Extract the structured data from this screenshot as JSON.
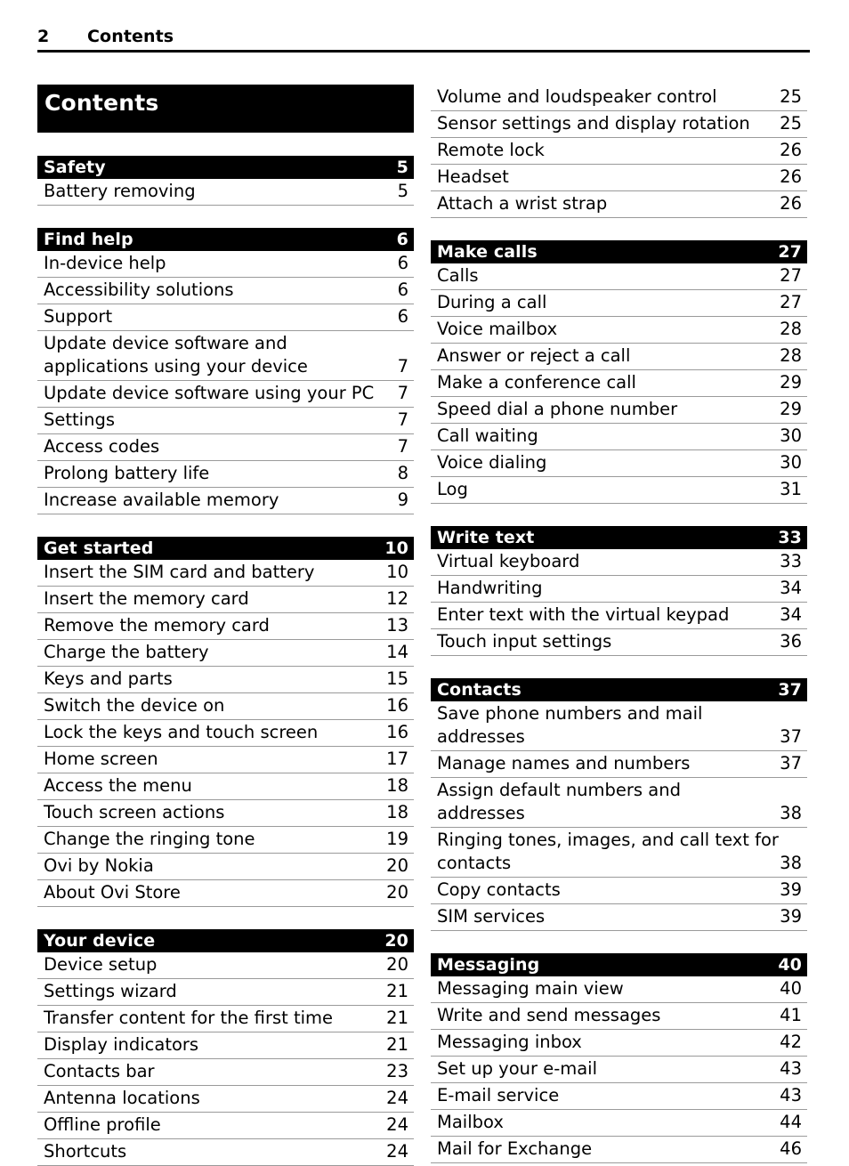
{
  "header": {
    "folio": "2",
    "title": "Contents"
  },
  "title_block": "Contents",
  "left_column": [
    {
      "chapter": {
        "label": "Safety",
        "page": "5"
      },
      "entries": [
        {
          "label": "Battery removing",
          "page": "5"
        }
      ]
    },
    {
      "chapter": {
        "label": "Find help",
        "page": "6"
      },
      "entries": [
        {
          "label": "In-device help",
          "page": "6"
        },
        {
          "label": "Accessibility solutions",
          "page": "6"
        },
        {
          "label": "Support",
          "page": "6"
        },
        {
          "label": "Update device software and",
          "label2": "applications using your device",
          "page": "7"
        },
        {
          "label": "Update device software using your PC",
          "page": "7"
        },
        {
          "label": "Settings",
          "page": "7"
        },
        {
          "label": "Access codes",
          "page": "7"
        },
        {
          "label": "Prolong battery life",
          "page": "8"
        },
        {
          "label": "Increase available memory",
          "page": "9"
        }
      ]
    },
    {
      "chapter": {
        "label": "Get started",
        "page": "10"
      },
      "entries": [
        {
          "label": "Insert the SIM card and battery",
          "page": "10"
        },
        {
          "label": "Insert the memory card",
          "page": "12"
        },
        {
          "label": "Remove the memory card",
          "page": "13"
        },
        {
          "label": "Charge the battery",
          "page": "14"
        },
        {
          "label": "Keys and parts",
          "page": "15"
        },
        {
          "label": "Switch the device on",
          "page": "16"
        },
        {
          "label": "Lock the keys and touch screen",
          "page": "16"
        },
        {
          "label": "Home screen",
          "page": "17"
        },
        {
          "label": "Access the menu",
          "page": "18"
        },
        {
          "label": "Touch screen actions",
          "page": "18"
        },
        {
          "label": "Change the ringing tone",
          "page": "19"
        },
        {
          "label": "Ovi by Nokia",
          "page": "20"
        },
        {
          "label": "About Ovi Store",
          "page": "20"
        }
      ]
    },
    {
      "chapter": {
        "label": "Your device",
        "page": "20"
      },
      "entries": [
        {
          "label": "Device setup",
          "page": "20"
        },
        {
          "label": "Settings wizard",
          "page": "21"
        },
        {
          "label": "Transfer content for the first time",
          "page": "21"
        },
        {
          "label": "Display indicators",
          "page": "21"
        },
        {
          "label": "Contacts bar",
          "page": "23"
        },
        {
          "label": "Antenna locations",
          "page": "24"
        },
        {
          "label": "Offline profile",
          "page": "24"
        },
        {
          "label": "Shortcuts",
          "page": "24"
        }
      ]
    }
  ],
  "right_column": [
    {
      "chapter": null,
      "entries": [
        {
          "label": "Volume and loudspeaker control",
          "page": "25"
        },
        {
          "label": "Sensor settings and display rotation",
          "page": "25"
        },
        {
          "label": "Remote lock",
          "page": "26"
        },
        {
          "label": "Headset",
          "page": "26"
        },
        {
          "label": "Attach a wrist strap",
          "page": "26"
        }
      ]
    },
    {
      "chapter": {
        "label": "Make calls",
        "page": "27"
      },
      "entries": [
        {
          "label": "Calls",
          "page": "27"
        },
        {
          "label": "During a call",
          "page": "27"
        },
        {
          "label": "Voice mailbox",
          "page": "28"
        },
        {
          "label": "Answer or reject a call",
          "page": "28"
        },
        {
          "label": "Make a conference call",
          "page": "29"
        },
        {
          "label": "Speed dial a phone number",
          "page": "29"
        },
        {
          "label": "Call waiting",
          "page": "30"
        },
        {
          "label": "Voice dialing",
          "page": "30"
        },
        {
          "label": "Log",
          "page": "31"
        }
      ]
    },
    {
      "chapter": {
        "label": "Write text",
        "page": "33"
      },
      "entries": [
        {
          "label": "Virtual keyboard",
          "page": "33"
        },
        {
          "label": "Handwriting",
          "page": "34"
        },
        {
          "label": "Enter text with the virtual keypad",
          "page": "34"
        },
        {
          "label": "Touch input settings",
          "page": "36"
        }
      ]
    },
    {
      "chapter": {
        "label": "Contacts",
        "page": "37"
      },
      "entries": [
        {
          "label": "Save phone numbers and mail",
          "label2": "addresses",
          "page": "37"
        },
        {
          "label": "Manage names and numbers",
          "page": "37"
        },
        {
          "label": "Assign default numbers and",
          "label2": "addresses",
          "page": "38"
        },
        {
          "label": "Ringing tones, images, and call text for",
          "label2": "contacts",
          "page": "38"
        },
        {
          "label": "Copy contacts",
          "page": "39"
        },
        {
          "label": "SIM services",
          "page": "39"
        }
      ]
    },
    {
      "chapter": {
        "label": "Messaging",
        "page": "40"
      },
      "entries": [
        {
          "label": "Messaging main view",
          "page": "40"
        },
        {
          "label": "Write and send messages",
          "page": "41"
        },
        {
          "label": "Messaging inbox",
          "page": "42"
        },
        {
          "label": "Set up your e-mail",
          "page": "43"
        },
        {
          "label": "E-mail service",
          "page": "43"
        },
        {
          "label": "Mailbox",
          "page": "44"
        },
        {
          "label": "Mail for Exchange",
          "page": "46"
        }
      ]
    }
  ]
}
